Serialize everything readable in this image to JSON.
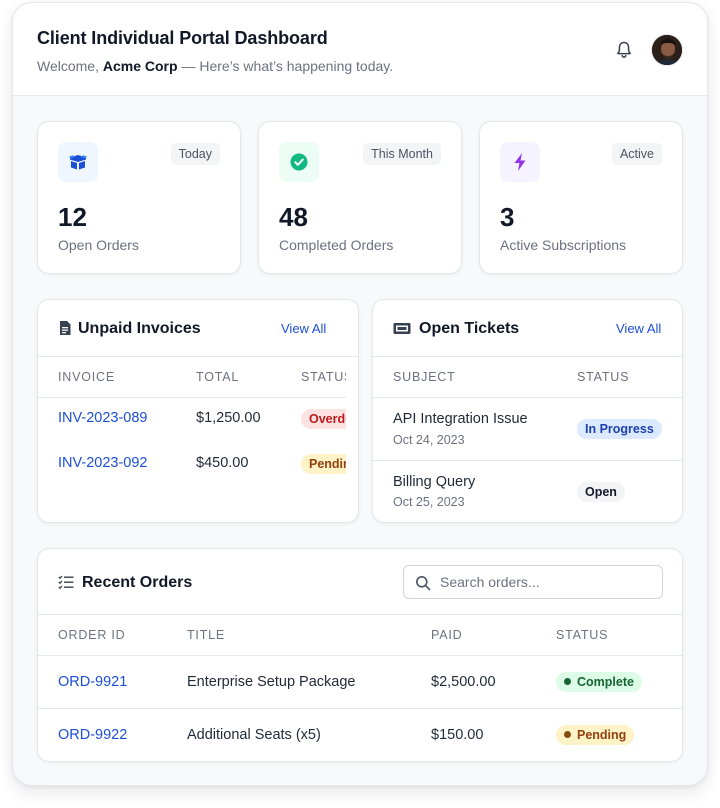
{
  "header": {
    "title": "Client Individual Portal Dashboard",
    "welcome_prefix": "Welcome,",
    "company": "Acme Corp",
    "welcome_suffix": "— Here’s what’s happening today."
  },
  "stats": [
    {
      "badge": "Today",
      "value": "12",
      "label": "Open Orders",
      "icon": "box-icon",
      "icon_bg": "#eff6ff",
      "icon_color": "#1d4ed8"
    },
    {
      "badge": "This Month",
      "value": "48",
      "label": "Completed Orders",
      "icon": "check-circle-icon",
      "icon_bg": "#ecfdf5",
      "icon_color": "#10b981"
    },
    {
      "badge": "Active",
      "value": "3",
      "label": "Active Subscriptions",
      "icon": "lightning-icon",
      "icon_bg": "#f5f3ff",
      "icon_color": "#9333ea"
    }
  ],
  "invoices": {
    "title": "Unpaid Invoices",
    "view_all": "View All",
    "columns": [
      "INVOICE",
      "TOTAL",
      "STATUS"
    ],
    "rows": [
      {
        "id": "INV-2023-089",
        "total": "$1,250.00",
        "status": "Overdue"
      },
      {
        "id": "INV-2023-092",
        "total": "$450.00",
        "status": "Pending"
      }
    ]
  },
  "tickets": {
    "title": "Open Tickets",
    "view_all": "View All",
    "columns": [
      "SUBJECT",
      "STATUS"
    ],
    "rows": [
      {
        "subject": "API Integration Issue",
        "date": "Oct 24, 2023",
        "status": "In Progress"
      },
      {
        "subject": "Billing Query",
        "date": "Oct 25, 2023",
        "status": "Open"
      }
    ]
  },
  "orders": {
    "title": "Recent Orders",
    "search_placeholder": "Search orders...",
    "columns": [
      "ORDER ID",
      "TITLE",
      "PAID",
      "STATUS"
    ],
    "rows": [
      {
        "id": "ORD-9921",
        "title": "Enterprise Setup Package",
        "paid": "$2,500.00",
        "status": "Complete"
      },
      {
        "id": "ORD-9922",
        "title": "Additional Seats (x5)",
        "paid": "$150.00",
        "status": "Pending"
      }
    ]
  },
  "colors": {
    "link": "#1d4ed8",
    "complete": "#16a34a",
    "pending": "#a16207"
  }
}
